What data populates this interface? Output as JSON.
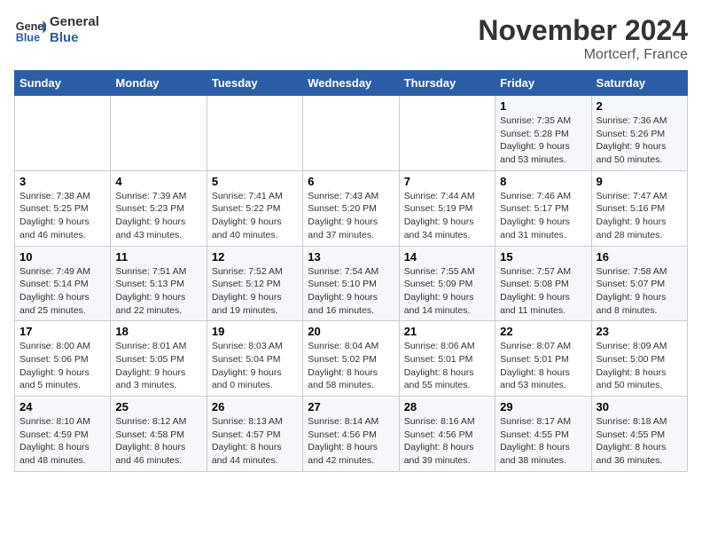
{
  "header": {
    "logo_general": "General",
    "logo_blue": "Blue",
    "month_title": "November 2024",
    "location": "Mortcerf, France"
  },
  "weekdays": [
    "Sunday",
    "Monday",
    "Tuesday",
    "Wednesday",
    "Thursday",
    "Friday",
    "Saturday"
  ],
  "weeks": [
    [
      {
        "day": "",
        "info": ""
      },
      {
        "day": "",
        "info": ""
      },
      {
        "day": "",
        "info": ""
      },
      {
        "day": "",
        "info": ""
      },
      {
        "day": "",
        "info": ""
      },
      {
        "day": "1",
        "info": "Sunrise: 7:35 AM\nSunset: 5:28 PM\nDaylight: 9 hours and 53 minutes."
      },
      {
        "day": "2",
        "info": "Sunrise: 7:36 AM\nSunset: 5:26 PM\nDaylight: 9 hours and 50 minutes."
      }
    ],
    [
      {
        "day": "3",
        "info": "Sunrise: 7:38 AM\nSunset: 5:25 PM\nDaylight: 9 hours and 46 minutes."
      },
      {
        "day": "4",
        "info": "Sunrise: 7:39 AM\nSunset: 5:23 PM\nDaylight: 9 hours and 43 minutes."
      },
      {
        "day": "5",
        "info": "Sunrise: 7:41 AM\nSunset: 5:22 PM\nDaylight: 9 hours and 40 minutes."
      },
      {
        "day": "6",
        "info": "Sunrise: 7:43 AM\nSunset: 5:20 PM\nDaylight: 9 hours and 37 minutes."
      },
      {
        "day": "7",
        "info": "Sunrise: 7:44 AM\nSunset: 5:19 PM\nDaylight: 9 hours and 34 minutes."
      },
      {
        "day": "8",
        "info": "Sunrise: 7:46 AM\nSunset: 5:17 PM\nDaylight: 9 hours and 31 minutes."
      },
      {
        "day": "9",
        "info": "Sunrise: 7:47 AM\nSunset: 5:16 PM\nDaylight: 9 hours and 28 minutes."
      }
    ],
    [
      {
        "day": "10",
        "info": "Sunrise: 7:49 AM\nSunset: 5:14 PM\nDaylight: 9 hours and 25 minutes."
      },
      {
        "day": "11",
        "info": "Sunrise: 7:51 AM\nSunset: 5:13 PM\nDaylight: 9 hours and 22 minutes."
      },
      {
        "day": "12",
        "info": "Sunrise: 7:52 AM\nSunset: 5:12 PM\nDaylight: 9 hours and 19 minutes."
      },
      {
        "day": "13",
        "info": "Sunrise: 7:54 AM\nSunset: 5:10 PM\nDaylight: 9 hours and 16 minutes."
      },
      {
        "day": "14",
        "info": "Sunrise: 7:55 AM\nSunset: 5:09 PM\nDaylight: 9 hours and 14 minutes."
      },
      {
        "day": "15",
        "info": "Sunrise: 7:57 AM\nSunset: 5:08 PM\nDaylight: 9 hours and 11 minutes."
      },
      {
        "day": "16",
        "info": "Sunrise: 7:58 AM\nSunset: 5:07 PM\nDaylight: 9 hours and 8 minutes."
      }
    ],
    [
      {
        "day": "17",
        "info": "Sunrise: 8:00 AM\nSunset: 5:06 PM\nDaylight: 9 hours and 5 minutes."
      },
      {
        "day": "18",
        "info": "Sunrise: 8:01 AM\nSunset: 5:05 PM\nDaylight: 9 hours and 3 minutes."
      },
      {
        "day": "19",
        "info": "Sunrise: 8:03 AM\nSunset: 5:04 PM\nDaylight: 9 hours and 0 minutes."
      },
      {
        "day": "20",
        "info": "Sunrise: 8:04 AM\nSunset: 5:02 PM\nDaylight: 8 hours and 58 minutes."
      },
      {
        "day": "21",
        "info": "Sunrise: 8:06 AM\nSunset: 5:01 PM\nDaylight: 8 hours and 55 minutes."
      },
      {
        "day": "22",
        "info": "Sunrise: 8:07 AM\nSunset: 5:01 PM\nDaylight: 8 hours and 53 minutes."
      },
      {
        "day": "23",
        "info": "Sunrise: 8:09 AM\nSunset: 5:00 PM\nDaylight: 8 hours and 50 minutes."
      }
    ],
    [
      {
        "day": "24",
        "info": "Sunrise: 8:10 AM\nSunset: 4:59 PM\nDaylight: 8 hours and 48 minutes."
      },
      {
        "day": "25",
        "info": "Sunrise: 8:12 AM\nSunset: 4:58 PM\nDaylight: 8 hours and 46 minutes."
      },
      {
        "day": "26",
        "info": "Sunrise: 8:13 AM\nSunset: 4:57 PM\nDaylight: 8 hours and 44 minutes."
      },
      {
        "day": "27",
        "info": "Sunrise: 8:14 AM\nSunset: 4:56 PM\nDaylight: 8 hours and 42 minutes."
      },
      {
        "day": "28",
        "info": "Sunrise: 8:16 AM\nSunset: 4:56 PM\nDaylight: 8 hours and 39 minutes."
      },
      {
        "day": "29",
        "info": "Sunrise: 8:17 AM\nSunset: 4:55 PM\nDaylight: 8 hours and 38 minutes."
      },
      {
        "day": "30",
        "info": "Sunrise: 8:18 AM\nSunset: 4:55 PM\nDaylight: 8 hours and 36 minutes."
      }
    ]
  ]
}
